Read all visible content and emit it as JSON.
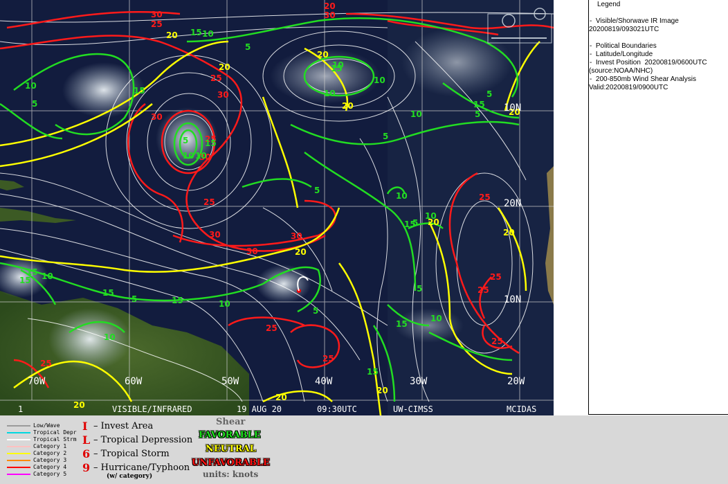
{
  "header_text": {
    "time_stamp": "1",
    "product": "VISIBLE/INFRARED",
    "date": "19 AUG 20",
    "time": "09:30UTC",
    "source": "UW-CIMSS",
    "system": "MCIDAS"
  },
  "latitude_labels": [
    "10N",
    "20N",
    "10N"
  ],
  "longitude_labels": [
    "70W",
    "60W",
    "50W",
    "40W",
    "30W",
    "20W"
  ],
  "contours": {
    "red": [
      "30",
      "25",
      "30",
      "20",
      "25",
      "30",
      "30",
      "25",
      "30",
      "25",
      "30",
      "30",
      "30",
      "25",
      "25",
      "25",
      "25",
      "25",
      "25",
      "25"
    ],
    "yellow": [
      "20",
      "20",
      "20",
      "20",
      "20",
      "20",
      "20",
      "20",
      "20",
      "20",
      "20"
    ],
    "green": [
      "15",
      "10",
      "5",
      "10",
      "5",
      "15",
      "10",
      "10",
      "10",
      "15",
      "5",
      "5",
      "10",
      "5",
      "5",
      "10",
      "15",
      "5",
      "10",
      "5",
      "15",
      "10",
      "15",
      "5",
      "15",
      "10",
      "5",
      "10",
      "15",
      "10",
      "15",
      "5",
      "10",
      "10",
      "15",
      "15",
      "15"
    ]
  },
  "right_panel": {
    "legend_title": "Legend",
    "lines": [
      "-  Visible/Shorwave IR Image",
      "20200819/093021UTC",
      "",
      "-  Political Boundaries",
      "-  Latitude/Longitude",
      "-  Invest Position  20200819/0600UTC",
      "(source:NOAA/NHC)",
      "-  200-850mb Wind Shear Analysis",
      "Valid:20200819/0900UTC"
    ]
  },
  "track_legend": [
    {
      "label": "Low/Wave",
      "color": "#9a9a9a"
    },
    {
      "label": "Tropical Depr",
      "color": "#00d8e0"
    },
    {
      "label": "Tropical Strm",
      "color": "#ffffff"
    },
    {
      "label": "Category 1",
      "color": "#ffc0c0"
    },
    {
      "label": "Category 2",
      "color": "#ffff00"
    },
    {
      "label": "Category 3",
      "color": "#ff8800"
    },
    {
      "label": "Category 4",
      "color": "#ff0000"
    },
    {
      "label": "Category 5",
      "color": "#ff00ff"
    }
  ],
  "symbol_legend": [
    {
      "glyph": "I",
      "label": "– Invest Area"
    },
    {
      "glyph": "L",
      "label": "– Tropical Depression"
    },
    {
      "glyph": "6",
      "label": "– Tropical Storm"
    },
    {
      "glyph": "9",
      "label": "– Hurricane/Typhoon"
    }
  ],
  "symbol_note": "(w/ category)",
  "shear_legend": {
    "title": "Shear",
    "favorable": "FAVORABLE",
    "neutral": "NEUTRAL",
    "unfavorable": "UNFAVORABLE",
    "units": "units: knots"
  },
  "colors": {
    "favorable": "#1ee01e",
    "neutral": "#ffff00",
    "unfavorable": "#ff1010",
    "contour_red": "#ff1a1a",
    "contour_yellow": "#ffff00",
    "contour_green": "#22dd22"
  }
}
